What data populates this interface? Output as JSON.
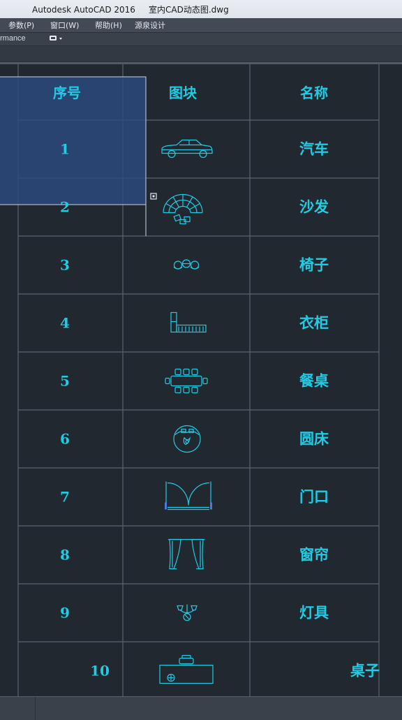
{
  "window": {
    "title": "Autodesk AutoCAD 2016     室内CAD动态图.dwg"
  },
  "menubar": {
    "items": [
      "参数(P)",
      "窗口(W)",
      "帮助(H)",
      "源泉设计"
    ]
  },
  "toolbar": {
    "workspace_partial": "rmance",
    "dropdown_icon": "display-toggle-icon"
  },
  "table": {
    "headers": [
      "序号",
      "图块",
      "名称"
    ],
    "rows": [
      {
        "index": "1",
        "block": "car-icon",
        "name": "汽车"
      },
      {
        "index": "2",
        "block": "sofa-icon",
        "name": "沙发"
      },
      {
        "index": "3",
        "block": "chairs-icon",
        "name": "椅子"
      },
      {
        "index": "4",
        "block": "wardrobe-icon",
        "name": "衣柜"
      },
      {
        "index": "5",
        "block": "dining-table-icon",
        "name": "餐桌"
      },
      {
        "index": "6",
        "block": "round-bed-icon",
        "name": "圆床"
      },
      {
        "index": "7",
        "block": "door-icon",
        "name": "门口"
      },
      {
        "index": "8",
        "block": "curtain-icon",
        "name": "窗帘"
      },
      {
        "index": "9",
        "block": "lamp-icon",
        "name": "灯具"
      },
      {
        "index": "10",
        "block": "desk-icon",
        "name": "桌子"
      }
    ]
  },
  "colors": {
    "line": "#5a6470",
    "text": "#22cbe4",
    "background": "#212830",
    "selection": "#2b4a80"
  }
}
